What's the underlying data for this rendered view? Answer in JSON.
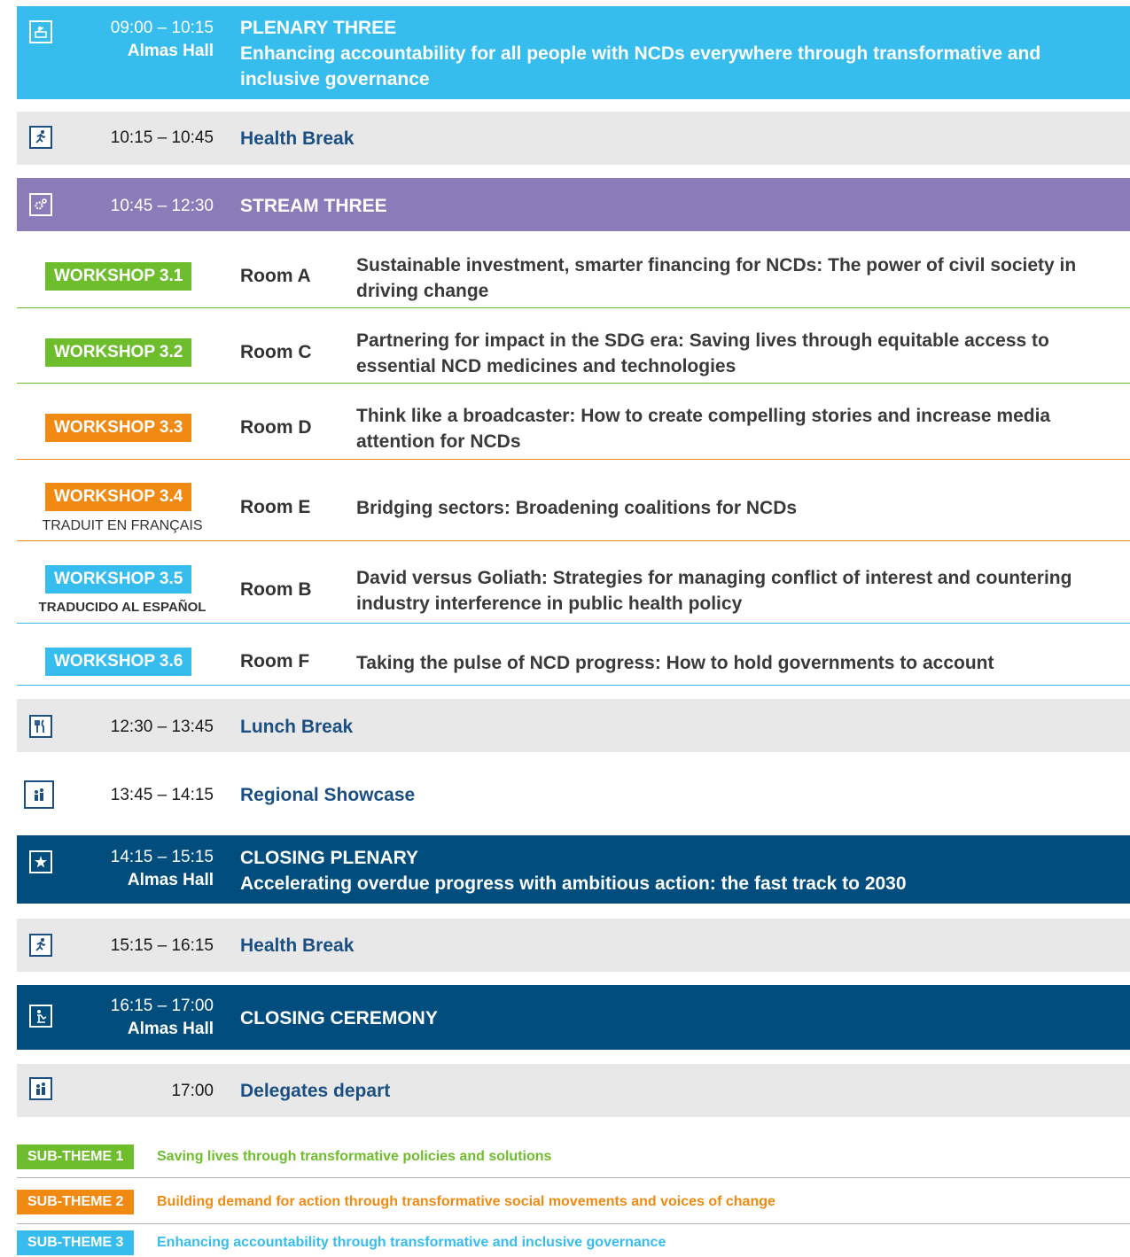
{
  "colors": {
    "green": "#6dbd2d",
    "orange": "#f08a12",
    "cyan": "#36bdee",
    "purple": "#8b7bb8",
    "navy": "#004d7e",
    "grey": "#e8e8e8",
    "link": "#1b4f83"
  },
  "plenary_three": {
    "icon": "speaker-icon",
    "time": "09:00 – 10:15",
    "venue": "Almas Hall",
    "title": "PLENARY THREE",
    "subtitle": "Enhancing accountability for all people with NCDs everywhere through transformative and inclusive governance"
  },
  "health_break_1": {
    "icon": "runner-icon",
    "time": "10:15 – 10:45",
    "title": "Health Break"
  },
  "stream_three": {
    "icon": "gears-icon",
    "time": "10:45 – 12:30",
    "title": "STREAM THREE"
  },
  "workshops": [
    {
      "badge": "WORKSHOP 3.1",
      "room": "Room A",
      "title": "Sustainable investment, smarter financing for NCDs: The power of civil society in driving change",
      "note": ""
    },
    {
      "badge": "WORKSHOP 3.2",
      "room": "Room C",
      "title": "Partnering for impact in the SDG era: Saving lives through equitable access to essential NCD medicines and technologies",
      "note": ""
    },
    {
      "badge": "WORKSHOP 3.3",
      "room": "Room D",
      "title": "Think like a broadcaster: How to create compelling stories and increase media attention for NCDs",
      "note": ""
    },
    {
      "badge": "WORKSHOP 3.4",
      "room": "Room E",
      "title": "Bridging sectors: Broadening coalitions for NCDs",
      "note": "TRADUIT EN FRANÇAIS"
    },
    {
      "badge": "WORKSHOP 3.5",
      "room": "Room B",
      "title": "David versus Goliath: Strategies for managing conflict of interest and countering industry interference in public health policy",
      "note": "TRADUCIDO AL ESPAÑOL"
    },
    {
      "badge": "WORKSHOP 3.6",
      "room": "Room F",
      "title": "Taking the pulse of NCD progress: How to hold governments to account",
      "note": ""
    }
  ],
  "lunch": {
    "icon": "cutlery-icon",
    "time": "12:30 – 13:45",
    "title": "Lunch Break"
  },
  "showcase": {
    "icon": "people-icon",
    "time": "13:45 – 14:15",
    "title": "Regional Showcase"
  },
  "closing_plenary": {
    "icon": "star-icon",
    "time": "14:15 – 15:15",
    "venue": "Almas Hall",
    "title": "CLOSING PLENARY",
    "subtitle": "Accelerating overdue progress with ambitious action: the fast track to 2030"
  },
  "health_break_2": {
    "icon": "runner-icon",
    "time": "15:15 – 16:15",
    "title": "Health Break"
  },
  "closing_ceremony": {
    "icon": "ceremony-icon",
    "time": "16:15 – 17:00",
    "venue": "Almas Hall",
    "title": "CLOSING CEREMONY"
  },
  "depart": {
    "icon": "people-icon",
    "time": "17:00",
    "title": "Delegates depart"
  },
  "legend": [
    {
      "badge": "SUB-THEME 1",
      "text": "Saving lives through transformative policies and solutions"
    },
    {
      "badge": "SUB-THEME 2",
      "text": "Building demand for action through transformative social movements and voices of change"
    },
    {
      "badge": "SUB-THEME 3",
      "text": "Enhancing accountability through transformative and inclusive governance"
    }
  ]
}
